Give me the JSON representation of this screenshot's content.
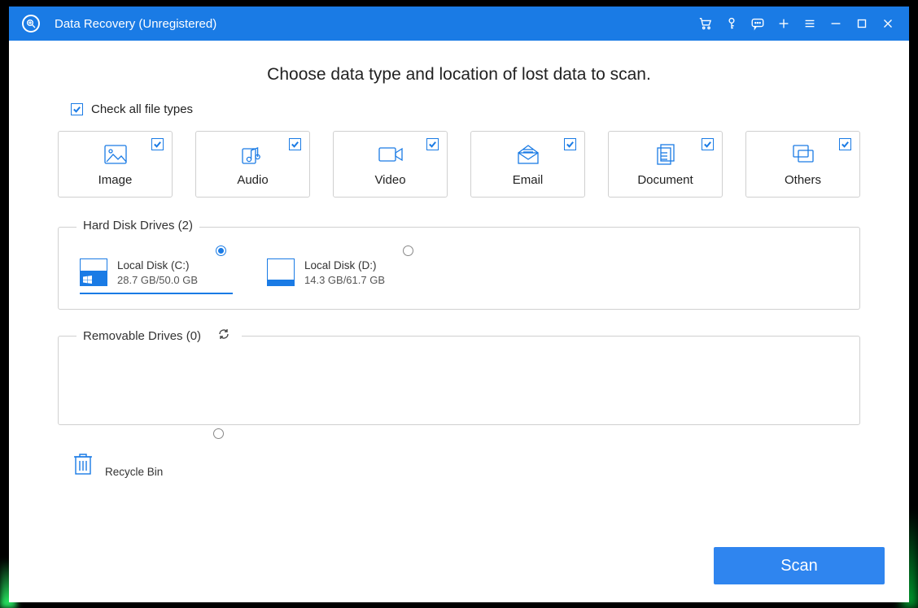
{
  "titlebar": {
    "title": "Data Recovery (Unregistered)"
  },
  "heading": "Choose data type and location of lost data to scan.",
  "check_all_label": "Check all file types",
  "types": [
    {
      "label": "Image"
    },
    {
      "label": "Audio"
    },
    {
      "label": "Video"
    },
    {
      "label": "Email"
    },
    {
      "label": "Document"
    },
    {
      "label": "Others"
    }
  ],
  "hdd_section": {
    "label": "Hard Disk Drives (2)"
  },
  "drives": [
    {
      "name": "Local Disk (C:)",
      "capacity": "28.7 GB/50.0 GB",
      "fill_pct": 57,
      "has_win": true
    },
    {
      "name": "Local Disk (D:)",
      "capacity": "14.3 GB/61.7 GB",
      "fill_pct": 23,
      "has_win": false
    }
  ],
  "removable_section": {
    "label": "Removable Drives (0)"
  },
  "recycle": {
    "label": "Recycle Bin"
  },
  "scan_label": "Scan"
}
